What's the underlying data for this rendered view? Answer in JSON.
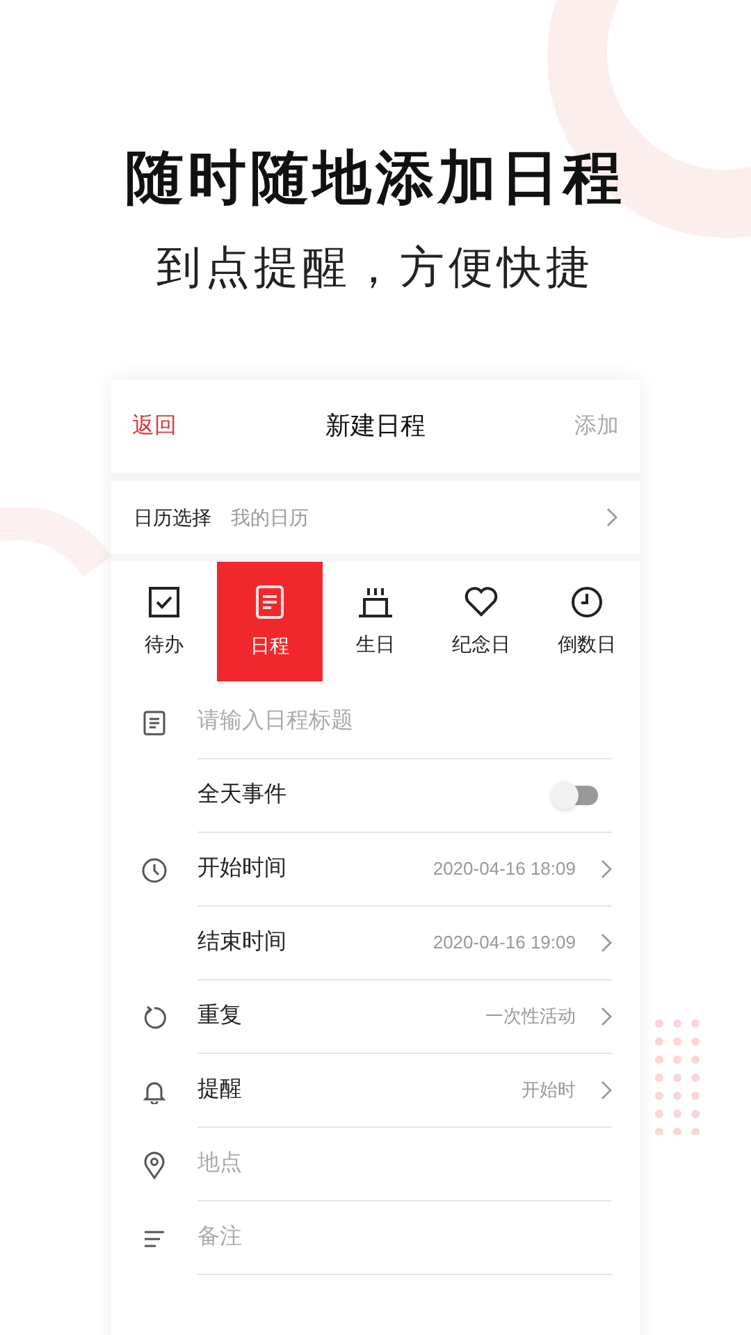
{
  "headline": "随时随地添加日程",
  "subheadline": "到点提醒，方便快捷",
  "header": {
    "back": "返回",
    "title": "新建日程",
    "action": "添加"
  },
  "calendar": {
    "label": "日历选择",
    "value": "我的日历"
  },
  "types": [
    {
      "label": "待办",
      "selected": false
    },
    {
      "label": "日程",
      "selected": true
    },
    {
      "label": "生日",
      "selected": false
    },
    {
      "label": "纪念日",
      "selected": false
    },
    {
      "label": "倒数日",
      "selected": false
    }
  ],
  "rows": [
    {
      "kind": "field",
      "placeholder": "请输入日程标题"
    },
    {
      "kind": "toggle",
      "label": "全天事件",
      "on": false
    },
    {
      "kind": "value",
      "label": "开始时间",
      "value": "2020-04-16 18:09"
    },
    {
      "kind": "value",
      "label": "结束时间",
      "value": "2020-04-16 19:09"
    },
    {
      "kind": "value",
      "label": "重复",
      "value": "一次性活动"
    },
    {
      "kind": "value",
      "label": "提醒",
      "value": "开始时"
    },
    {
      "kind": "field",
      "placeholder": "地点"
    },
    {
      "kind": "field",
      "placeholder": "备注"
    }
  ]
}
